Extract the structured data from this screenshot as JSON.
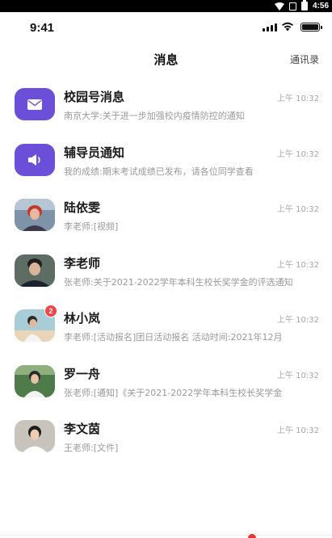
{
  "android_status": {
    "time": "4:56"
  },
  "ios_status": {
    "time": "9:41",
    "signal_bars": 4,
    "battery_level": 1.0
  },
  "nav": {
    "title": "消息",
    "contacts_label": "通讯录"
  },
  "conversations": [
    {
      "title": "校园号消息",
      "preview": "南京大学:关于进一步加强校内疫情防控的通知",
      "time": "上午 10:32",
      "avatar_icon": "envelope-icon",
      "avatar_color": "#6b4fd8"
    },
    {
      "title": "辅导员通知",
      "preview": "我的成绩:期末考试成绩已发布，请各位同学查看",
      "time": "上午 10:32",
      "avatar_icon": "megaphone-icon",
      "avatar_color": "#6b4fd8"
    },
    {
      "title": "陆依雯",
      "preview": "李老师:[视频]",
      "time": "上午 10:32",
      "avatar_icon": "user-photo"
    },
    {
      "title": "李老师",
      "preview": "张老师:关于2021-2022学年本科生校长奖学金的评选通知",
      "time": "上午 10:32",
      "avatar_icon": "user-photo"
    },
    {
      "title": "林小岚",
      "preview": "李老师:[活动报名]团日活动报名 活动时间:2021年12月",
      "time": "上午 10:32",
      "avatar_icon": "user-photo",
      "unread": "2"
    },
    {
      "title": "罗一舟",
      "preview": "张老师:[通知]《关于2021-2022学年本科生校长奖学金",
      "time": "上午 10:32",
      "avatar_icon": "user-photo"
    },
    {
      "title": "李文茵",
      "preview": "王老师:[文件]",
      "time": "上午 10:32",
      "avatar_icon": "user-photo"
    }
  ],
  "colors": {
    "accent": "#6b4fd8",
    "badge": "#f0464a",
    "subtitle": "#999999"
  }
}
